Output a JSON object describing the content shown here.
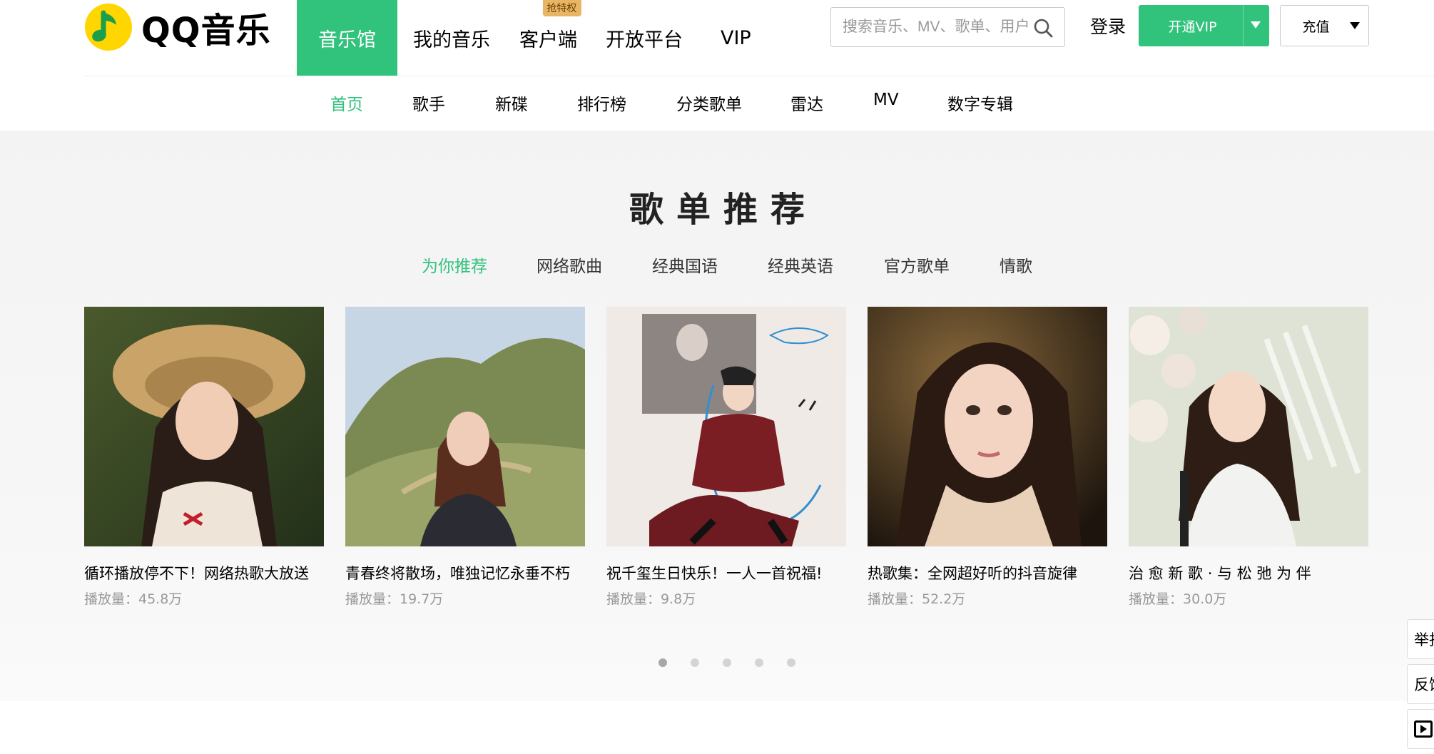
{
  "brand": {
    "name": "QQ音乐",
    "accent": "#31c27c",
    "logo_color": "#ffd600"
  },
  "main_nav": [
    {
      "label": "音乐馆",
      "active": true
    },
    {
      "label": "我的音乐",
      "active": false
    },
    {
      "label": "客户端",
      "active": false,
      "badge": "抢特权"
    },
    {
      "label": "开放平台",
      "active": false
    },
    {
      "label": "VIP",
      "active": false
    }
  ],
  "search": {
    "placeholder": "搜索音乐、MV、歌单、用户",
    "icon": "search-icon"
  },
  "login_label": "登录",
  "vip_button": {
    "label": "开通VIP"
  },
  "recharge_button": {
    "label": "充值"
  },
  "sub_nav": [
    {
      "label": "首页",
      "active": true
    },
    {
      "label": "歌手"
    },
    {
      "label": "新碟"
    },
    {
      "label": "排行榜"
    },
    {
      "label": "分类歌单"
    },
    {
      "label": "雷达"
    },
    {
      "label": "MV"
    },
    {
      "label": "数字专辑"
    }
  ],
  "section": {
    "title": "歌单推荐",
    "tabs": [
      {
        "label": "为你推荐",
        "active": true
      },
      {
        "label": "网络歌曲"
      },
      {
        "label": "经典国语"
      },
      {
        "label": "经典英语"
      },
      {
        "label": "官方歌单"
      },
      {
        "label": "情歌"
      }
    ],
    "playlists": [
      {
        "title": "循环播放停不下！网络热歌大放送",
        "plays": "播放量：45.8万"
      },
      {
        "title": "青春终将散场，唯独记忆永垂不朽",
        "plays": "播放量：19.7万"
      },
      {
        "title": "祝千玺生日快乐！一人一首祝福!",
        "plays": "播放量：9.8万"
      },
      {
        "title": "热歌集：全网超好听的抖音旋律",
        "plays": "播放量：52.2万"
      },
      {
        "title": "治 愈 新 歌 · 与 松 弛 为 伴",
        "plays": "播放量：30.0万"
      }
    ],
    "carousel": {
      "pages": 5,
      "current": 1
    }
  },
  "float_tools": [
    {
      "label": "举报",
      "icon": "report"
    },
    {
      "label": "反馈",
      "icon": "feedback"
    },
    {
      "label": "",
      "icon": "play-video-icon"
    }
  ]
}
